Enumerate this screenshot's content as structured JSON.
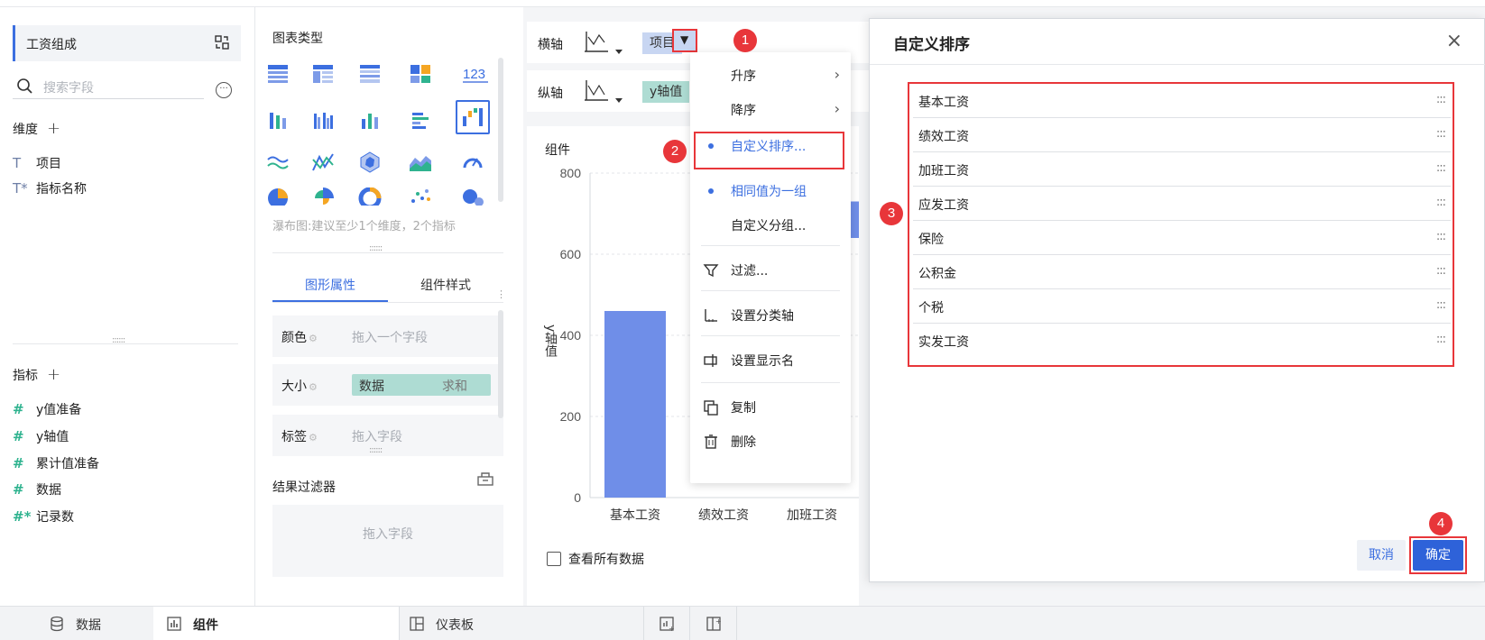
{
  "left": {
    "dataset_title": "工资组成",
    "search_placeholder": "搜索字段",
    "more_symbol": "···",
    "dimensions_label": "维度",
    "dimensions": [
      {
        "sym": "T",
        "label": "项目"
      },
      {
        "sym": "T*",
        "label": "指标名称"
      }
    ],
    "measures_label": "指标",
    "measures": [
      {
        "sym": "#",
        "label": "y值准备"
      },
      {
        "sym": "#",
        "label": "y轴值"
      },
      {
        "sym": "#",
        "label": "累计值准备"
      },
      {
        "sym": "#",
        "label": "数据"
      },
      {
        "sym": "#*",
        "label": "记录数"
      }
    ]
  },
  "middle": {
    "chart_type_title": "图表类型",
    "hint": "瀑布图:建议至少1个维度，2个指标",
    "tabs": [
      "图形属性",
      "组件样式"
    ],
    "props": {
      "color_label": "颜色",
      "color_placeholder": "拖入一个字段",
      "size_label": "大小",
      "size_field": "数据",
      "size_agg": "求和",
      "label_label": "标签",
      "label_placeholder": "拖入字段"
    },
    "filter_title": "结果过滤器",
    "filter_placeholder": "拖入字段"
  },
  "axes": {
    "x_label": "横轴",
    "x_field": "项目",
    "y_label": "纵轴",
    "y_field": "y轴值"
  },
  "chart": {
    "card_title": "组件",
    "show_all_data": "查看所有数据"
  },
  "chart_data": {
    "type": "bar",
    "categories": [
      "基本工资",
      "绩效工资",
      "加班工资"
    ],
    "values": [
      460,
      null,
      null
    ],
    "ylabel": "y轴值",
    "ylim": [
      0,
      800
    ],
    "yticks": [
      0,
      200,
      400,
      600,
      800
    ],
    "grid": true
  },
  "menu": {
    "items": [
      {
        "label": "升序",
        "submenu": true
      },
      {
        "label": "降序",
        "submenu": true
      },
      {
        "label": "自定义排序...",
        "active": true
      },
      {
        "label": "相同值为一组",
        "active": true
      },
      {
        "label": "自定义分组..."
      },
      {
        "label": "过滤..."
      },
      {
        "label": "设置分类轴"
      },
      {
        "label": "设置显示名"
      },
      {
        "label": "复制"
      },
      {
        "label": "删除"
      }
    ]
  },
  "dialog": {
    "title": "自定义排序",
    "close": "×",
    "items": [
      "基本工资",
      "绩效工资",
      "加班工资",
      "应发工资",
      "保险",
      "公积金",
      "个税",
      "实发工资"
    ],
    "grip": ":::",
    "cancel": "取消",
    "ok": "确定"
  },
  "badges": [
    "1",
    "2",
    "3",
    "4"
  ],
  "bottom": {
    "tabs": [
      "数据",
      "组件",
      "仪表板"
    ]
  },
  "colors": {
    "accent": "#3c6fe0",
    "bar": "#6f8ee8",
    "highlight_red": "#e8363a",
    "measure_green": "#2fb38f"
  }
}
